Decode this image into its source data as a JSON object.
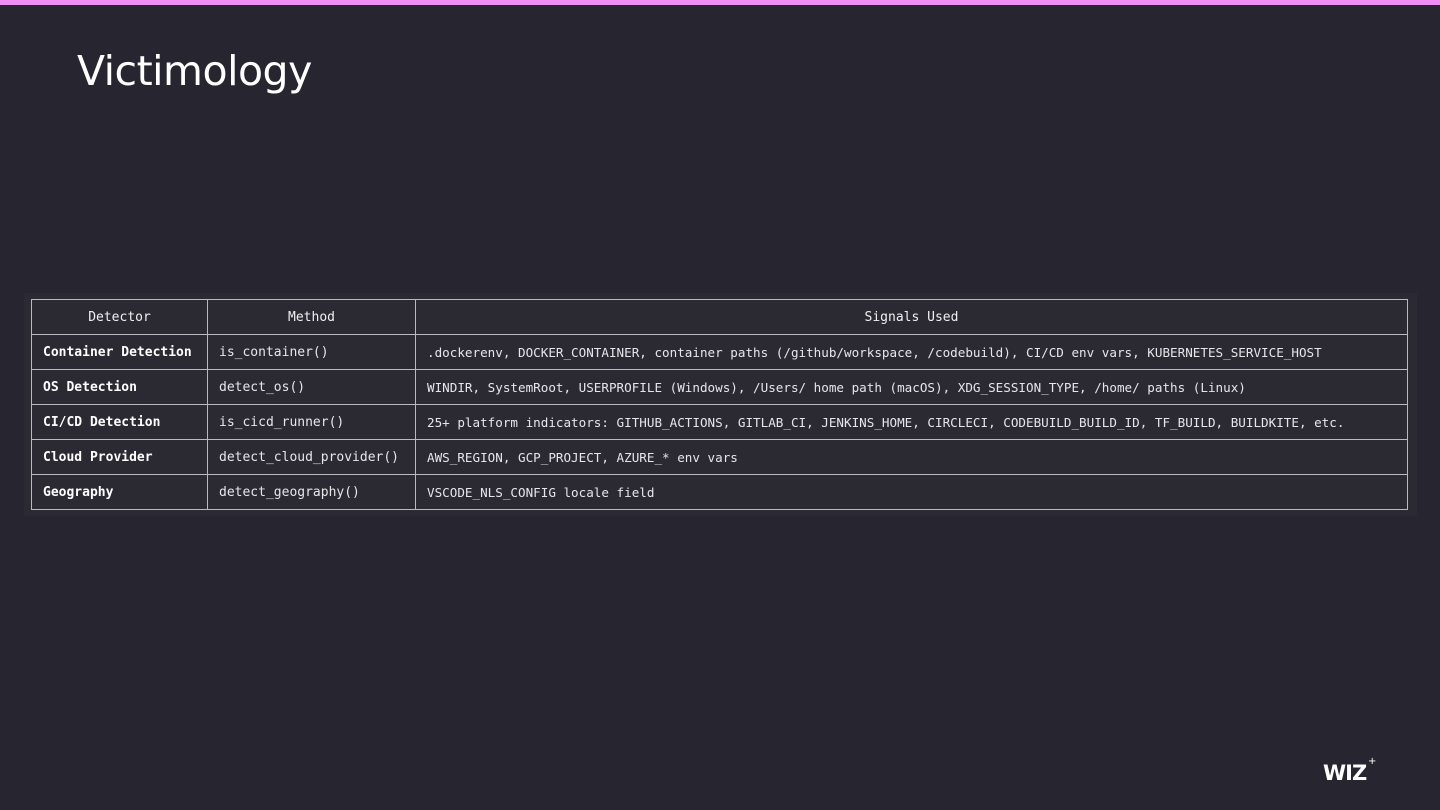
{
  "slide": {
    "title": "Victimology",
    "accent_color": "#ee8ef5",
    "background_color": "#272630"
  },
  "table": {
    "headers": [
      "Detector",
      "Method",
      "Signals Used"
    ],
    "rows": [
      {
        "detector": "Container Detection",
        "method": "is_container()",
        "signals": ".dockerenv, DOCKER_CONTAINER, container paths (/github/workspace, /codebuild), CI/CD env vars, KUBERNETES_SERVICE_HOST"
      },
      {
        "detector": "OS Detection",
        "method": "detect_os()",
        "signals": "WINDIR, SystemRoot, USERPROFILE (Windows), /Users/ home path (macOS), XDG_SESSION_TYPE, /home/ paths (Linux)"
      },
      {
        "detector": "CI/CD Detection",
        "method": "is_cicd_runner()",
        "signals": "25+ platform indicators: GITHUB_ACTIONS, GITLAB_CI, JENKINS_HOME, CIRCLECI, CODEBUILD_BUILD_ID, TF_BUILD, BUILDKITE, etc."
      },
      {
        "detector": "Cloud Provider",
        "method": "detect_cloud_provider()",
        "signals": "AWS_REGION, GCP_PROJECT, AZURE_* env vars"
      },
      {
        "detector": "Geography",
        "method": "detect_geography()",
        "signals": "VSCODE_NLS_CONFIG locale field"
      }
    ]
  },
  "logo": {
    "text": "WIZ",
    "mark": "+",
    "icon": "wiz-logo-icon"
  }
}
